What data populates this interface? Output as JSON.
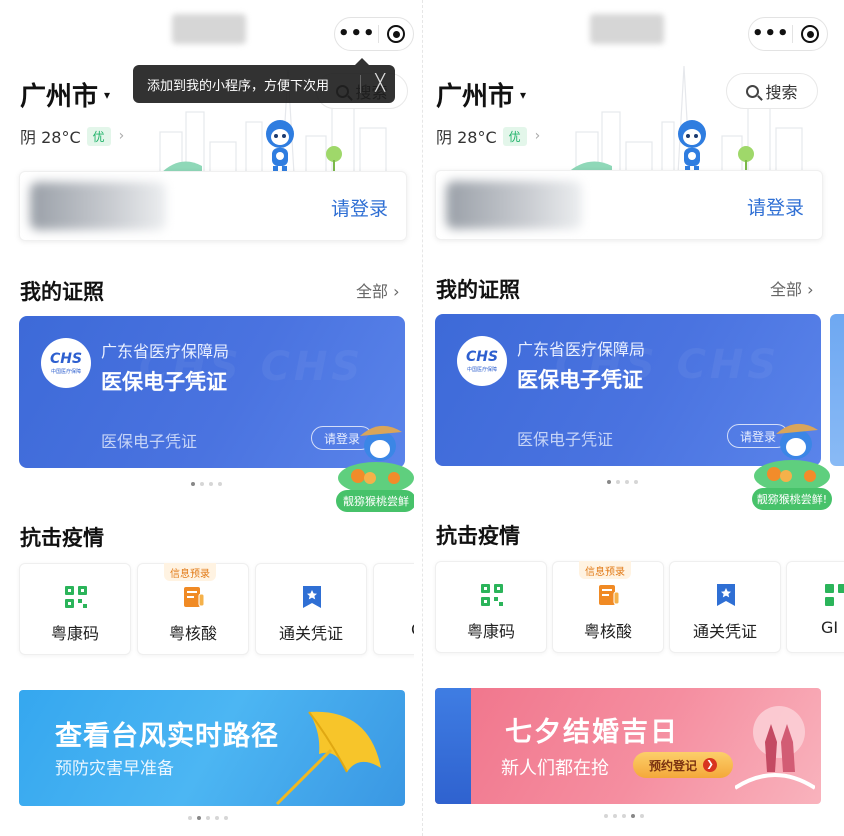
{
  "capsule": {
    "more_label": "•••"
  },
  "tooltip": {
    "text": "添加到我的小程序，方便下次用",
    "close": "╳"
  },
  "header": {
    "city": "广州市",
    "city_caret": "▾",
    "weather": "阴 28°C",
    "air_quality": "优",
    "weather_chevron": "›",
    "search_label_left": "搜索",
    "search_label_right": "搜索"
  },
  "login": {
    "button_label": "请登录"
  },
  "certificates": {
    "title": "我的证照",
    "view_all": "全部 ›",
    "card": {
      "issuer": "广东省医疗保障局",
      "name": "医保电子凭证",
      "label": "医保电子凭证",
      "login_button": "请登录",
      "logo_mark": "CHS",
      "logo_sub": "中国医疗保障",
      "watermark": "CHS CHS"
    },
    "promo_tag_left": "靓猕猴桃尝鲜",
    "promo_tag_right": "靓猕猴桃尝鲜!"
  },
  "epidemic": {
    "title": "抗击疫情",
    "tiles": [
      {
        "label": "粤康码",
        "icon": "qr-code-icon",
        "color": "#2bb45a"
      },
      {
        "label": "粤核酸",
        "icon": "nucleic-test-icon",
        "color": "#f08a24",
        "badge": "信息预录"
      },
      {
        "label": "通关凭证",
        "icon": "pass-badge-icon",
        "color": "#2f6fd4"
      },
      {
        "label_left": "G",
        "label_right": "GI",
        "icon": "qr-code-icon",
        "color": "#2bb45a"
      }
    ]
  },
  "banners": {
    "typhoon": {
      "title": "查看台风实时路径",
      "subtitle": "预防灾害早准备"
    },
    "qixi": {
      "title": "七夕结婚吉日",
      "subtitle": "新人们都在抢",
      "button": "预约登记",
      "arrow": "❯"
    }
  },
  "colors": {
    "accent_blue": "#2f6fd4",
    "card_blue": "#4a73e0",
    "green": "#2bb45a",
    "orange": "#f08a24"
  }
}
